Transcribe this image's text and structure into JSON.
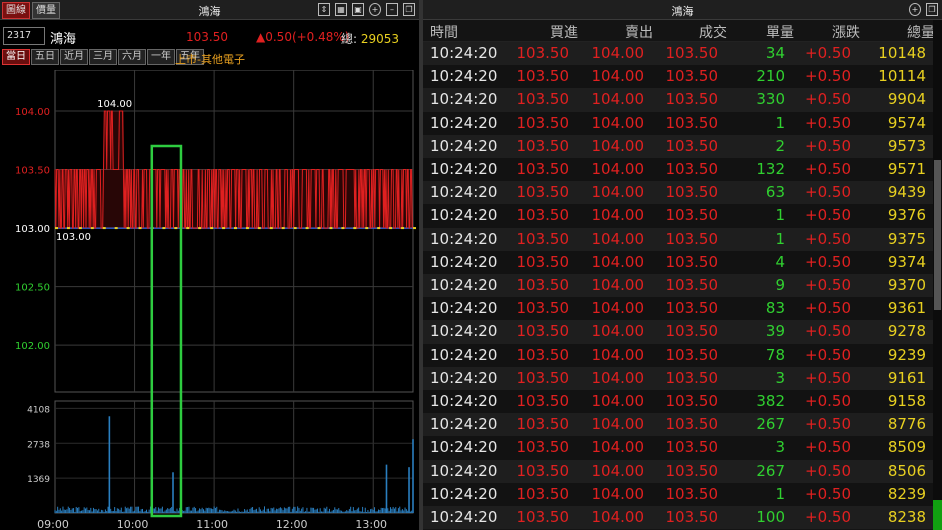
{
  "left": {
    "tabs": [
      "圖線",
      "價量"
    ],
    "title": "鴻海",
    "toolbar_icons": [
      "arrows-icon",
      "grid-icon",
      "save-icon",
      "plus-icon",
      "minimize-icon",
      "restore-icon"
    ],
    "code": "2317",
    "name": "鴻海",
    "last": "103.50",
    "change": "▲0.50(+0.48%)",
    "total_label": "總:",
    "total_value": "29053",
    "periods": [
      "當日",
      "五日",
      "近月",
      "三月",
      "六月",
      "一年",
      "五年"
    ],
    "market": "上市-其他電子"
  },
  "chart_data": {
    "type": "line",
    "title": "",
    "price_ticks": [
      "104.00",
      "103.50",
      "103.00",
      "102.50",
      "102.00"
    ],
    "price_tick_values": [
      104.0,
      103.5,
      103.0,
      102.5,
      102.0
    ],
    "price_tick_colors": [
      "#e02020",
      "#e02020",
      "#ffffff",
      "#30d030",
      "#30d030"
    ],
    "ylim": [
      101.6,
      104.35
    ],
    "volume_ticks": [
      "4108",
      "2738",
      "1369"
    ],
    "volume_tick_values": [
      4108,
      2738,
      1369
    ],
    "volume_ylim": [
      0,
      4400
    ],
    "time_ticks": [
      "09:00",
      "10:00",
      "11:00",
      "12:00",
      "13:00"
    ],
    "annotations": [
      "104.00",
      "103.00"
    ],
    "reference_price": 103.0,
    "colors": {
      "up": "#e02020",
      "down": "#e8d020",
      "ref": "#2a5fd0",
      "volume": "#2a7fc0",
      "highlight": "#2ecc40"
    },
    "price_series": [
      {
        "t": "09:00",
        "p": 103.5
      },
      {
        "t": "09:35",
        "p": 103.5
      },
      {
        "t": "09:37",
        "p": 104.0
      },
      {
        "t": "09:52",
        "p": 104.0
      },
      {
        "t": "09:53",
        "p": 103.5
      },
      {
        "t": "10:20",
        "p": 103.5
      },
      {
        "t": "10:30",
        "p": 103.5
      },
      {
        "t": "11:00",
        "p": 103.5
      },
      {
        "t": "12:00",
        "p": 103.5
      },
      {
        "t": "13:00",
        "p": 103.5
      },
      {
        "t": "13:30",
        "p": 103.5
      }
    ],
    "highlight_window": [
      "10:13",
      "10:35"
    ],
    "volume_spikes": [
      {
        "t": "09:41",
        "v": 3800
      },
      {
        "t": "10:29",
        "v": 1600
      },
      {
        "t": "13:10",
        "v": 1900
      },
      {
        "t": "13:27",
        "v": 1800
      },
      {
        "t": "13:30",
        "v": 2900
      }
    ]
  },
  "right": {
    "title": "鴻海",
    "headers": [
      "時間",
      "買進",
      "賣出",
      "成交",
      "單量",
      "漲跌",
      "總量"
    ],
    "rows": [
      [
        "10:24:20",
        "103.50",
        "104.00",
        "103.50",
        "34",
        "+0.50",
        "10148"
      ],
      [
        "10:24:20",
        "103.50",
        "104.00",
        "103.50",
        "210",
        "+0.50",
        "10114"
      ],
      [
        "10:24:20",
        "103.50",
        "104.00",
        "103.50",
        "330",
        "+0.50",
        "9904"
      ],
      [
        "10:24:20",
        "103.50",
        "104.00",
        "103.50",
        "1",
        "+0.50",
        "9574"
      ],
      [
        "10:24:20",
        "103.50",
        "104.00",
        "103.50",
        "2",
        "+0.50",
        "9573"
      ],
      [
        "10:24:20",
        "103.50",
        "104.00",
        "103.50",
        "132",
        "+0.50",
        "9571"
      ],
      [
        "10:24:20",
        "103.50",
        "104.00",
        "103.50",
        "63",
        "+0.50",
        "9439"
      ],
      [
        "10:24:20",
        "103.50",
        "104.00",
        "103.50",
        "1",
        "+0.50",
        "9376"
      ],
      [
        "10:24:20",
        "103.50",
        "104.00",
        "103.50",
        "1",
        "+0.50",
        "9375"
      ],
      [
        "10:24:20",
        "103.50",
        "104.00",
        "103.50",
        "4",
        "+0.50",
        "9374"
      ],
      [
        "10:24:20",
        "103.50",
        "104.00",
        "103.50",
        "9",
        "+0.50",
        "9370"
      ],
      [
        "10:24:20",
        "103.50",
        "104.00",
        "103.50",
        "83",
        "+0.50",
        "9361"
      ],
      [
        "10:24:20",
        "103.50",
        "104.00",
        "103.50",
        "39",
        "+0.50",
        "9278"
      ],
      [
        "10:24:20",
        "103.50",
        "104.00",
        "103.50",
        "78",
        "+0.50",
        "9239"
      ],
      [
        "10:24:20",
        "103.50",
        "104.00",
        "103.50",
        "3",
        "+0.50",
        "9161"
      ],
      [
        "10:24:20",
        "103.50",
        "104.00",
        "103.50",
        "382",
        "+0.50",
        "9158"
      ],
      [
        "10:24:20",
        "103.50",
        "104.00",
        "103.50",
        "267",
        "+0.50",
        "8776"
      ],
      [
        "10:24:20",
        "103.50",
        "104.00",
        "103.50",
        "3",
        "+0.50",
        "8509"
      ],
      [
        "10:24:20",
        "103.50",
        "104.00",
        "103.50",
        "267",
        "+0.50",
        "8506"
      ],
      [
        "10:24:20",
        "103.50",
        "104.00",
        "103.50",
        "1",
        "+0.50",
        "8239"
      ],
      [
        "10:24:20",
        "103.50",
        "104.00",
        "103.50",
        "100",
        "+0.50",
        "8238"
      ]
    ]
  }
}
